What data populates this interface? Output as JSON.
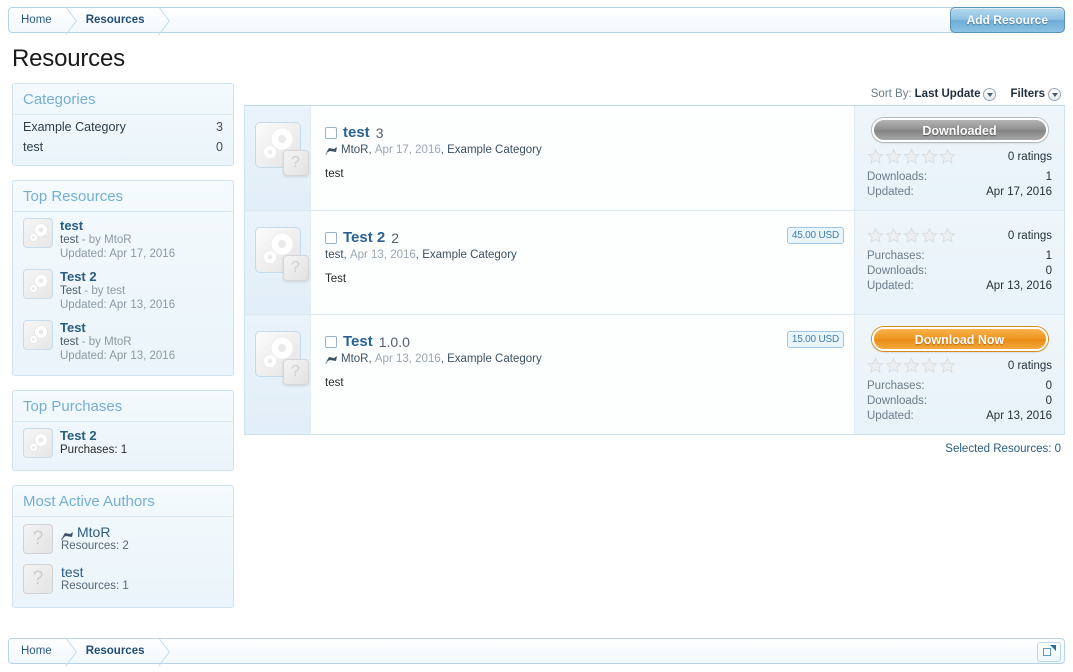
{
  "breadcrumb": {
    "home": "Home",
    "current": "Resources",
    "popup_icon": "external-link-icon"
  },
  "header": {
    "add_resource_label": "Add Resource",
    "page_title": "Resources"
  },
  "sidebar": {
    "categories": {
      "heading": "Categories",
      "items": [
        {
          "label": "Example Category",
          "count": "3"
        },
        {
          "label": "test",
          "count": "0"
        }
      ]
    },
    "top_resources": {
      "heading": "Top Resources",
      "items": [
        {
          "title": "test",
          "desc": "test",
          "by": "- by MtoR",
          "updated": "Updated: Apr 17, 2016"
        },
        {
          "title": "Test 2",
          "desc": "Test",
          "by": "- by test",
          "updated": "Updated: Apr 13, 2016"
        },
        {
          "title": "Test",
          "desc": "test",
          "by": "- by MtoR",
          "updated": "Updated: Apr 13, 2016"
        }
      ]
    },
    "top_purchases": {
      "heading": "Top Purchases",
      "items": [
        {
          "title": "Test 2",
          "stat": "Purchases: 1"
        }
      ]
    },
    "most_active_authors": {
      "heading": "Most Active Authors",
      "items": [
        {
          "name": "MtoR",
          "stat": "Resources: 2",
          "has_flag": true
        },
        {
          "name": "test",
          "stat": "Resources: 1",
          "has_flag": false
        }
      ]
    }
  },
  "toolbar": {
    "sort_label": "Sort By:",
    "sort_value": "Last Update",
    "filters_label": "Filters"
  },
  "resources": [
    {
      "title": "test",
      "version": "3",
      "author": "MtoR",
      "has_flag": true,
      "date": "Apr 17, 2016",
      "category": "Example Category",
      "description": "test",
      "price": null,
      "button": {
        "label": "Downloaded",
        "style": "gray"
      },
      "ratings_text": "0 ratings",
      "stars": 0,
      "stats": [
        {
          "key": "Downloads:",
          "value": "1"
        },
        {
          "key": "Updated:",
          "value": "Apr 17, 2016"
        }
      ]
    },
    {
      "title": "Test 2",
      "version": "2",
      "author": "test",
      "has_flag": false,
      "date": "Apr 13, 2016",
      "category": "Example Category",
      "description": "Test",
      "price": "45.00 USD",
      "button": null,
      "ratings_text": "0 ratings",
      "stars": 0,
      "stats": [
        {
          "key": "Purchases:",
          "value": "1"
        },
        {
          "key": "Downloads:",
          "value": "0"
        },
        {
          "key": "Updated:",
          "value": "Apr 13, 2016"
        }
      ]
    },
    {
      "title": "Test",
      "version": "1.0.0",
      "author": "MtoR",
      "has_flag": true,
      "date": "Apr 13, 2016",
      "category": "Example Category",
      "description": "test",
      "price": "15.00 USD",
      "button": {
        "label": "Download Now",
        "style": "orange"
      },
      "ratings_text": "0 ratings",
      "stars": 0,
      "stats": [
        {
          "key": "Purchases:",
          "value": "0"
        },
        {
          "key": "Downloads:",
          "value": "0"
        },
        {
          "key": "Updated:",
          "value": "Apr 13, 2016"
        }
      ]
    }
  ],
  "selected_resources": "Selected Resources: 0",
  "colors": {
    "accent_blue": "#2a5d82",
    "heading_blue": "#76aed3",
    "orange_button": "#ef9420",
    "price_border": "#9fc6e2"
  }
}
